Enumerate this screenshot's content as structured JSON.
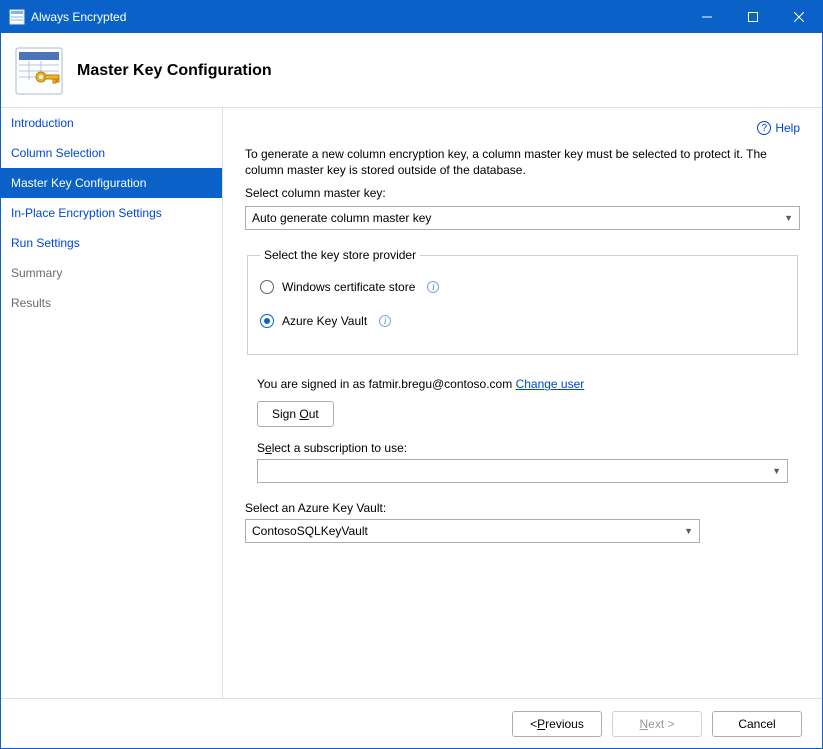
{
  "window": {
    "title": "Always Encrypted"
  },
  "header": {
    "title": "Master Key Configuration"
  },
  "sidebar": {
    "items": [
      {
        "label": "Introduction",
        "state": "link"
      },
      {
        "label": "Column Selection",
        "state": "link"
      },
      {
        "label": "Master Key Configuration",
        "state": "selected"
      },
      {
        "label": "In-Place Encryption Settings",
        "state": "link"
      },
      {
        "label": "Run Settings",
        "state": "link"
      },
      {
        "label": "Summary",
        "state": "disabled"
      },
      {
        "label": "Results",
        "state": "disabled"
      }
    ]
  },
  "help": {
    "label": "Help"
  },
  "main": {
    "intro": "To generate a new column encryption key, a column master key must be selected to protect it.  The column master key is stored outside of the database.",
    "select_cmk_label": "Select column master key:",
    "select_cmk_value": "Auto generate column master key",
    "provider_legend": "Select the key store provider",
    "option_win": "Windows certificate store",
    "option_akv": "Azure Key Vault",
    "signed_in_prefix": "You are signed in as fatmir.bregu@contoso.com ",
    "change_user": "Change user",
    "sign_out_prefix": "Sign ",
    "sign_out_u": "O",
    "sign_out_suffix": "ut",
    "sub_label_prefix": "S",
    "sub_label_u": "e",
    "sub_label_suffix": "lect a subscription to use:",
    "sub_value": "",
    "vault_label": "Select an Azure Key Vault:",
    "vault_value": "ContosoSQLKeyVault"
  },
  "footer": {
    "previous_pre": "< ",
    "previous_u": "P",
    "previous_suf": "revious",
    "next_u": "N",
    "next_suf": "ext >",
    "cancel": "Cancel"
  }
}
